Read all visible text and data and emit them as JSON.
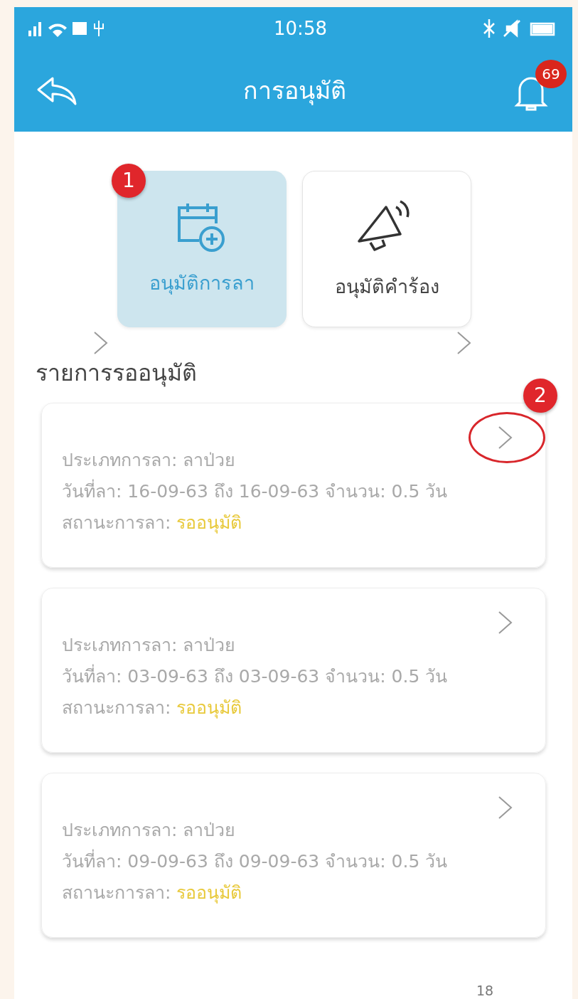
{
  "status_bar": {
    "time": "10:58"
  },
  "header": {
    "title": "การอนุมัติ",
    "notification_count": "69"
  },
  "categories": [
    {
      "label": "อนุมัติการลา",
      "kind": "calendar",
      "selected": true,
      "marker": "1"
    },
    {
      "label": "อนุมัติคำร้อง",
      "kind": "megaphone",
      "selected": false
    }
  ],
  "section_title": "รายการรออนุมัติ",
  "requests": [
    {
      "type_line": "ประเภทการลา: ลาป่วย",
      "dates": "วันที่ลา: 16-09-63 ถึง 16-09-63 จำนวน: 0.5 วัน",
      "status_label": "สถานะการลา:",
      "status": "รออนุมัติ",
      "marker": "2",
      "circled": true
    },
    {
      "type_line": "ประเภทการลา: ลาป่วย",
      "dates": "วันที่ลา: 03-09-63 ถึง 03-09-63 จำนวน: 0.5 วัน",
      "status_label": "สถานะการลา:",
      "status": "รออนุมัติ",
      "circled": false
    },
    {
      "type_line": "ประเภทการลา: ลาป่วย",
      "dates": "วันที่ลา: 09-09-63 ถึง 09-09-63 จำนวน: 0.5 วัน",
      "status_label": "สถานะการลา:",
      "status": "รออนุมัติ",
      "circled": false
    }
  ],
  "page_number": "18"
}
